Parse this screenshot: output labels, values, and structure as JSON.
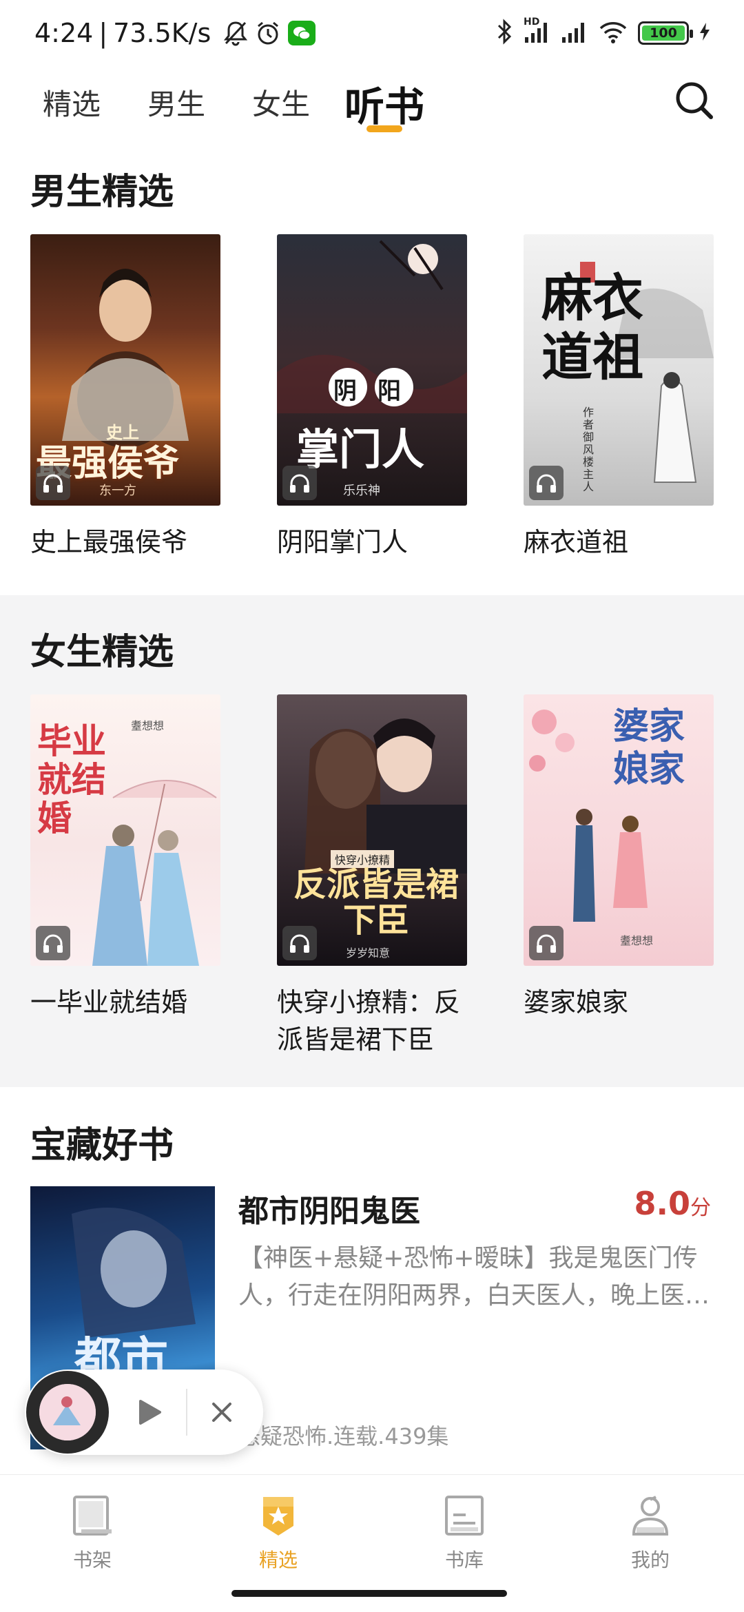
{
  "status_bar": {
    "time": "4:24",
    "separator": "|",
    "speed": "73.5K/s",
    "battery": "100",
    "battery_level": 1.0,
    "hd_label": "HD",
    "icons": [
      "mute-bell-icon",
      "alarm-icon",
      "wechat-icon",
      "bluetooth-icon",
      "signal-icon",
      "wifi-icon",
      "charging-icon"
    ]
  },
  "top_tabs": [
    {
      "label": "精选",
      "active": false
    },
    {
      "label": "男生",
      "active": false
    },
    {
      "label": "女生",
      "active": false
    },
    {
      "label": "听书",
      "active": true
    }
  ],
  "sections": {
    "male": {
      "title": "男生精选",
      "books": [
        {
          "name": "史上最强侯爷",
          "cover_title": "最强侯爷",
          "cover_small": "史上",
          "cover_author": "东一方"
        },
        {
          "name": "阴阳掌门人",
          "cover_title": "掌门人",
          "cover_small": "阴阳",
          "cover_author": "乐乐神"
        },
        {
          "name": "麻衣道祖",
          "cover_title": "麻衣道祖",
          "cover_author": "作者 御风楼主人"
        }
      ]
    },
    "female": {
      "title": "女生精选",
      "books": [
        {
          "name": "一毕业就结婚",
          "cover_title": "毕业就结婚",
          "cover_author": "耋想想"
        },
        {
          "name": "快穿小撩精：反派皆是裙下臣",
          "cover_title": "反派皆是裙下臣",
          "cover_small": "快穿小撩精",
          "cover_author": "岁岁知意"
        },
        {
          "name": "婆家娘家",
          "cover_title": "婆家娘家",
          "cover_author": "耋想想"
        }
      ]
    },
    "treasure": {
      "title": "宝藏好书",
      "book": {
        "name": "都市阴阳鬼医",
        "score": "8.0",
        "score_unit": "分",
        "cover_text": "都市",
        "desc_line1": "【神医+悬疑+恐怖+暧昧】我是鬼医门传",
        "desc_line2": "人，行走在阴阳两界，白天医人，晚上医…",
        "meta": "悬疑恐怖.连载.439集"
      }
    }
  },
  "bottom_nav": [
    {
      "label": "书架",
      "icon": "bookshelf-icon",
      "active": false
    },
    {
      "label": "精选",
      "icon": "featured-star-icon",
      "active": true
    },
    {
      "label": "书库",
      "icon": "library-icon",
      "active": false
    },
    {
      "label": "我的",
      "icon": "profile-icon",
      "active": false
    }
  ],
  "colors": {
    "accent": "#f2a61c",
    "score": "#c8403a",
    "section_gray": "#f4f4f5"
  }
}
